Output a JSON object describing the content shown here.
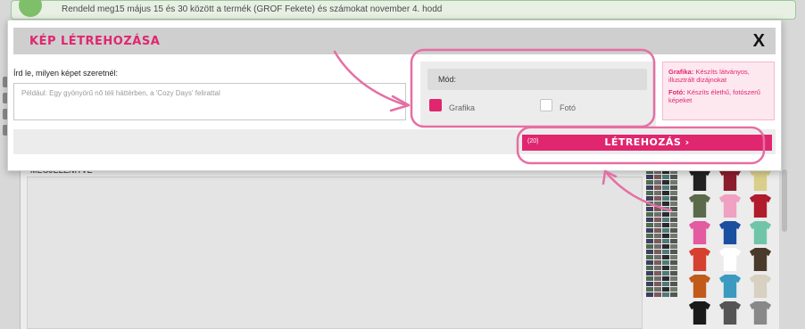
{
  "background": {
    "banner_text": "Rendeld meg15 május 15 és 30 között a termék (GROF Fekete) és számokat november 4. hodd",
    "panel_title": "MEGJELENÍTVE",
    "swatch_colors": [
      "#4d6b4e",
      "#6e6e6e",
      "#2a2a2a",
      "#6e7a6a",
      "#3e3e5e",
      "#7a5a5a",
      "#4e7a7a",
      "#555555"
    ],
    "shirt_colors": [
      "#222222",
      "#8b1c2c",
      "#d9cf8a",
      "#5b6b4a",
      "#f0a0c0",
      "#b01c2c",
      "#e35ba0",
      "#1a4fa0",
      "#6fc5a8",
      "#d64030",
      "#ffffff",
      "#4a3a2a",
      "#c25a1a",
      "#3a9ac0",
      "#d8d0c0",
      "#1a1a1a",
      "#555555",
      "#888888"
    ]
  },
  "modal": {
    "title": "KÉP LÉTREHOZÁSA",
    "close_label": "X",
    "prompt_label": "Írd le, milyen képet szeretnél:",
    "prompt_placeholder": "Például: Egy gyönyörű nő téli háttérben, a 'Cozy Days' felirattal",
    "prompt_value": "",
    "mode_label": "Mód:",
    "options": [
      {
        "label": "Grafika",
        "checked": true
      },
      {
        "label": "Fotó",
        "checked": false
      }
    ],
    "info": {
      "grafika_title": "Grafika:",
      "grafika_text": " Készíts látványos, illusztrált dizájnokat",
      "foto_title": "Fotó:",
      "foto_text": " Készíts élethű, fotószerű képeket"
    },
    "create_button": {
      "count": "(20)",
      "label": "LÉTREHOZÁS"
    }
  },
  "colors": {
    "accent": "#e0266f",
    "annotation": "#e56fa3"
  }
}
